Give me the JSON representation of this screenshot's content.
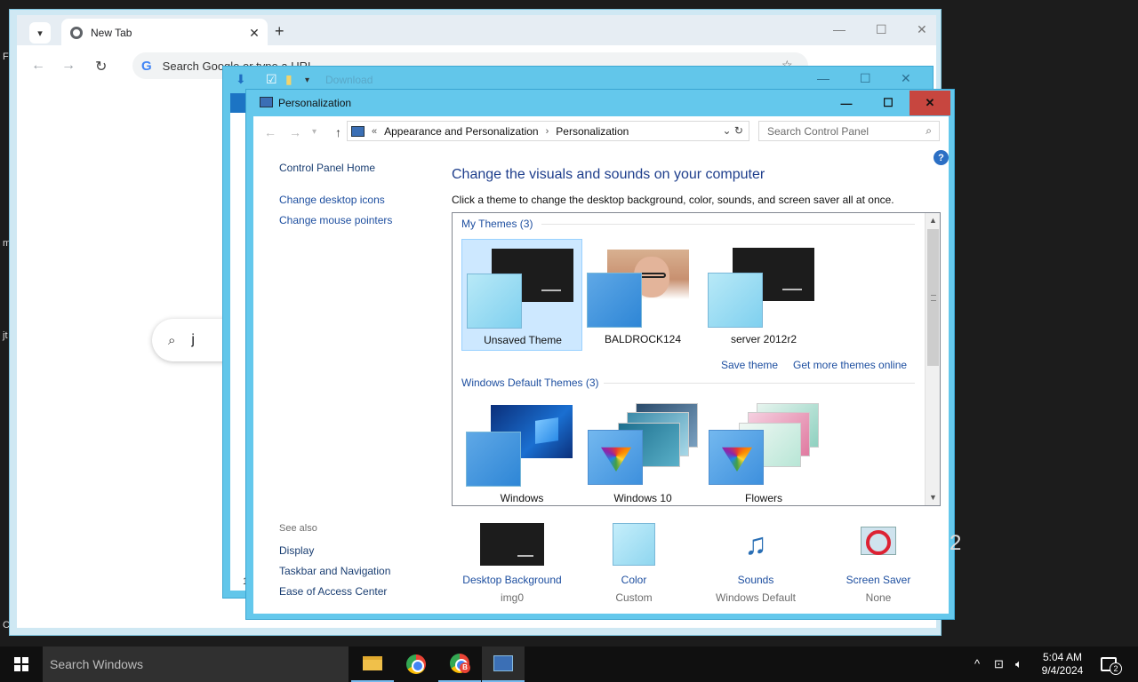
{
  "desktop": {
    "edge_chars": [
      "F",
      "m",
      "jt",
      "C"
    ],
    "edge_big": "2"
  },
  "chrome": {
    "tab_title": "New Tab",
    "tab_close": "✕",
    "new_tab": "+",
    "minimize": "—",
    "maximize": "☐",
    "close": "✕",
    "omnibox_placeholder": "Search Google or type a URL",
    "ntp_search_text": "j",
    "icons": [
      "tab-search-icon",
      "chrome-favicon",
      "back-icon",
      "forward-icon",
      "reload-icon",
      "google-g-icon",
      "star-icon",
      "extensions-icon",
      "profile-icon"
    ]
  },
  "explorer": {
    "title": "Download",
    "bottom_char": "1"
  },
  "personalization": {
    "window_title": "Personalization",
    "breadcrumbs": [
      "Appearance and Personalization",
      "Personalization"
    ],
    "breadcrumb_prefix": "«",
    "search_placeholder": "Search Control Panel",
    "left_links": [
      "Control Panel Home",
      "Change desktop icons",
      "Change mouse pointers"
    ],
    "see_also_label": "See also",
    "see_also_links": [
      "Display",
      "Taskbar and Navigation",
      "Ease of Access Center"
    ],
    "heading": "Change the visuals and sounds on your computer",
    "subheading": "Click a theme to change the desktop background, color, sounds, and screen saver all at once.",
    "my_themes_header": "My Themes (3)",
    "my_themes": [
      {
        "label": "Unsaved Theme",
        "selected": true
      },
      {
        "label": "BALDROCK124",
        "selected": false
      },
      {
        "label": "server 2012r2",
        "selected": false
      }
    ],
    "save_theme": "Save theme",
    "get_more": "Get more themes online",
    "default_themes_header": "Windows Default Themes (3)",
    "default_themes": [
      {
        "label": "Windows"
      },
      {
        "label": "Windows 10"
      },
      {
        "label": "Flowers"
      }
    ],
    "bottom": [
      {
        "label": "Desktop Background",
        "sub": "img0"
      },
      {
        "label": "Color",
        "sub": "Custom"
      },
      {
        "label": "Sounds",
        "sub": "Windows Default"
      },
      {
        "label": "Screen Saver",
        "sub": "None"
      }
    ],
    "help": "?"
  },
  "taskbar": {
    "search_placeholder": "Search Windows",
    "apps": [
      "file-explorer",
      "chrome",
      "chrome-profile-b",
      "control-panel"
    ],
    "badge": "B",
    "time": "5:04 AM",
    "date": "9/4/2024",
    "notification_count": "2"
  },
  "colors": {
    "window_border": "#64c8ec",
    "link": "#1e4fa0",
    "close_red": "#c7463f",
    "selection": "#cde8ff",
    "taskbar": "#101010"
  }
}
